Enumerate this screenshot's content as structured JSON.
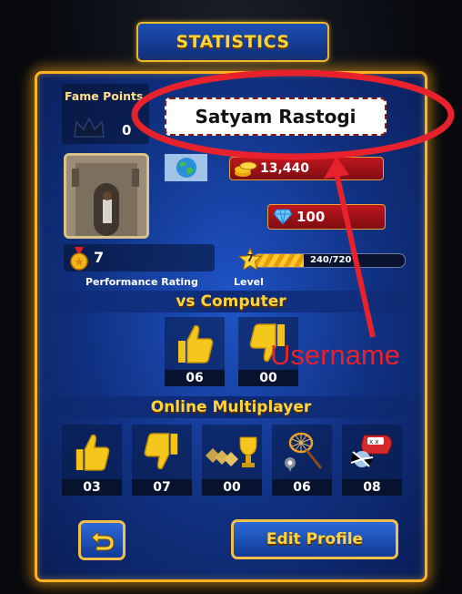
{
  "header": {
    "title": "STATISTICS"
  },
  "profile": {
    "fame_points_label": "Fame Points",
    "fame_points_value": "0",
    "username": "Satyam Rastogi",
    "coins": "13,440",
    "gems": "100",
    "performance_rating_value": "7",
    "performance_rating_label": "Performance Rating",
    "level_number": "7",
    "level_progress_text": "240/720",
    "level_progress_fraction": 0.333,
    "level_label": "Level"
  },
  "vs_computer": {
    "title": "vs Computer",
    "stats": [
      {
        "icon": "thumbs-up-icon",
        "value": "06"
      },
      {
        "icon": "thumbs-down-icon",
        "value": "00"
      }
    ]
  },
  "online": {
    "title": "Online Multiplayer",
    "stats": [
      {
        "icon": "thumbs-up-icon",
        "value": "03"
      },
      {
        "icon": "thumbs-down-icon",
        "value": "07"
      },
      {
        "icon": "trophy-streak-icon",
        "value": "00"
      },
      {
        "icon": "net-catch-icon",
        "value": "06"
      },
      {
        "icon": "boxing-glove-icon",
        "value": "08"
      }
    ]
  },
  "buttons": {
    "edit_profile": "Edit Profile"
  },
  "annotation": {
    "text": "Username",
    "color": "#e8222c"
  },
  "colors": {
    "gold": "#ffd43a",
    "panel_blue": "#1f54c8",
    "border_gold": "#ffb21e"
  }
}
